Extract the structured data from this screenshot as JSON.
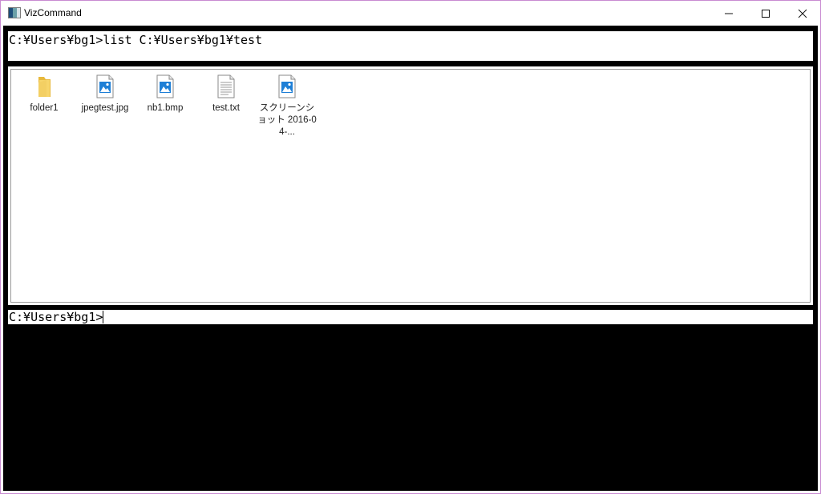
{
  "window": {
    "title": "VizCommand"
  },
  "command_box": {
    "text": "C:¥Users¥bg1>list C:¥Users¥bg1¥test"
  },
  "files": [
    {
      "name": "folder1",
      "icon": "folder-icon"
    },
    {
      "name": "jpegtest.jpg",
      "icon": "image-file-icon"
    },
    {
      "name": "nb1.bmp",
      "icon": "image-file-icon"
    },
    {
      "name": "test.txt",
      "icon": "text-file-icon"
    },
    {
      "name": "スクリーンショット 2016-04-...",
      "icon": "image-file-icon"
    }
  ],
  "prompt": {
    "text": "C:¥Users¥bg1>"
  },
  "colors": {
    "background": "#000000",
    "panel": "#ffffff",
    "border": "#c98bd1",
    "image_icon": "#1e7fd6",
    "folder_icon": "#f3cf63"
  }
}
